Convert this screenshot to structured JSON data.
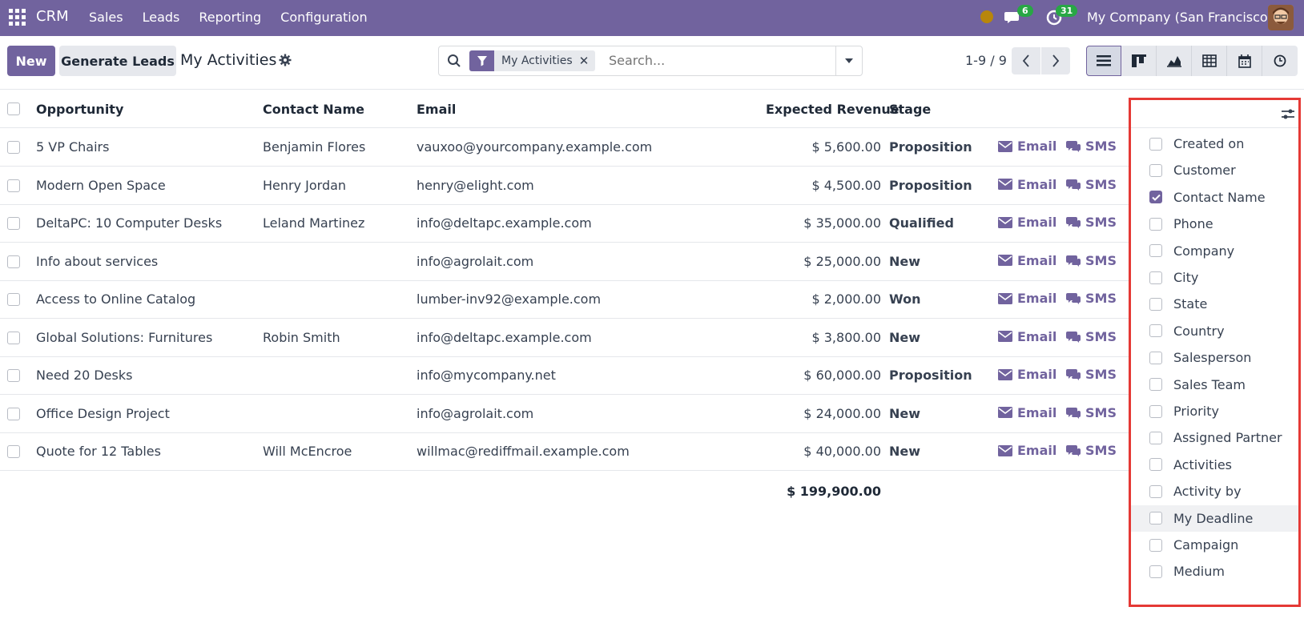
{
  "navbar": {
    "brand": "CRM",
    "menu": [
      "Sales",
      "Leads",
      "Reporting",
      "Configuration"
    ],
    "chat_badge": "6",
    "activity_badge": "31",
    "company": "My Company (San Francisco)"
  },
  "control": {
    "new_label": "New",
    "generate_label": "Generate Leads",
    "title": "My Activities",
    "facet_label": "My Activities",
    "facet_close": "✕",
    "search_placeholder": "Search...",
    "pager": "1-9 / 9"
  },
  "table": {
    "headers": {
      "opportunity": "Opportunity",
      "contact": "Contact Name",
      "email": "Email",
      "revenue": "Expected Revenue",
      "stage": "Stage"
    },
    "rows": [
      {
        "opportunity": "5 VP Chairs",
        "contact": "Benjamin Flores",
        "email": "vauxoo@yourcompany.example.com",
        "revenue": "$ 5,600.00",
        "stage": "Proposition"
      },
      {
        "opportunity": "Modern Open Space",
        "contact": "Henry Jordan",
        "email": "henry@elight.com",
        "revenue": "$ 4,500.00",
        "stage": "Proposition"
      },
      {
        "opportunity": "DeltaPC: 10 Computer Desks",
        "contact": "Leland Martinez",
        "email": "info@deltapc.example.com",
        "revenue": "$ 35,000.00",
        "stage": "Qualified"
      },
      {
        "opportunity": "Info about services",
        "contact": "",
        "email": "info@agrolait.com",
        "revenue": "$ 25,000.00",
        "stage": "New"
      },
      {
        "opportunity": "Access to Online Catalog",
        "contact": "",
        "email": "lumber-inv92@example.com",
        "revenue": "$ 2,000.00",
        "stage": "Won"
      },
      {
        "opportunity": "Global Solutions: Furnitures",
        "contact": "Robin Smith",
        "email": "info@deltapc.example.com",
        "revenue": "$ 3,800.00",
        "stage": "New"
      },
      {
        "opportunity": "Need 20 Desks",
        "contact": "",
        "email": "info@mycompany.net",
        "revenue": "$ 60,000.00",
        "stage": "Proposition"
      },
      {
        "opportunity": "Office Design Project",
        "contact": "",
        "email": "info@agrolait.com",
        "revenue": "$ 24,000.00",
        "stage": "New"
      },
      {
        "opportunity": "Quote for 12 Tables",
        "contact": "Will McEncroe",
        "email": "willmac@rediffmail.example.com",
        "revenue": "$ 40,000.00",
        "stage": "New"
      }
    ],
    "email_action": "Email",
    "sms_action": "SMS",
    "total": "$ 199,900.00"
  },
  "optional_columns": [
    {
      "label": "Created on",
      "checked": false
    },
    {
      "label": "Customer",
      "checked": false
    },
    {
      "label": "Contact Name",
      "checked": true
    },
    {
      "label": "Phone",
      "checked": false
    },
    {
      "label": "Company",
      "checked": false
    },
    {
      "label": "City",
      "checked": false
    },
    {
      "label": "State",
      "checked": false
    },
    {
      "label": "Country",
      "checked": false
    },
    {
      "label": "Salesperson",
      "checked": false
    },
    {
      "label": "Sales Team",
      "checked": false
    },
    {
      "label": "Priority",
      "checked": false
    },
    {
      "label": "Assigned Partner",
      "checked": false
    },
    {
      "label": "Activities",
      "checked": false
    },
    {
      "label": "Activity by",
      "checked": false
    },
    {
      "label": "My Deadline",
      "checked": false
    },
    {
      "label": "Campaign",
      "checked": false
    },
    {
      "label": "Medium",
      "checked": false
    }
  ],
  "colors": {
    "brand": "#71639e",
    "badge": "#28a745",
    "highlight": "#e53935"
  },
  "icons": [
    "apps-icon",
    "chat-icon",
    "clock-icon",
    "gear-icon",
    "search-icon",
    "filter-icon",
    "caret-down-icon",
    "chevron-left-icon",
    "chevron-right-icon",
    "list-view-icon",
    "kanban-view-icon",
    "graph-view-icon",
    "pivot-view-icon",
    "calendar-view-icon",
    "activity-view-icon",
    "envelope-icon",
    "sms-icon",
    "sliders-icon"
  ]
}
